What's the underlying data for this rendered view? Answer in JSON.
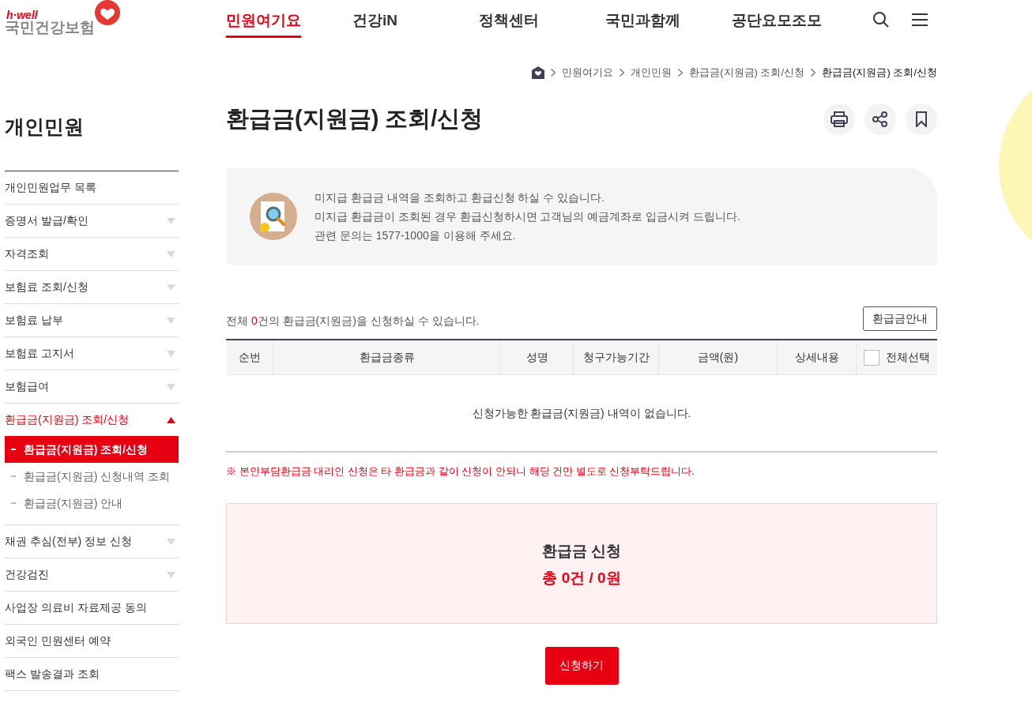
{
  "logo": {
    "tagline": "h·well",
    "name": "국민건강보험"
  },
  "nav": [
    {
      "label": "민원여기요",
      "selected": true
    },
    {
      "label": "건강iN",
      "selected": false
    },
    {
      "label": "정책센터",
      "selected": false
    },
    {
      "label": "국민과함께",
      "selected": false
    },
    {
      "label": "공단요모조모",
      "selected": false
    }
  ],
  "breadcrumb": [
    "민원여기요",
    "개인민원",
    "환급금(지원금) 조회/신청",
    "환급금(지원금) 조회/신청"
  ],
  "sidebar": {
    "title": "개인민원",
    "items": [
      {
        "label": "개인민원업무 목록",
        "kind": "link",
        "selected": false
      },
      {
        "label": "증명서 발급/확인",
        "kind": "toggle",
        "expanded": false,
        "selected": false
      },
      {
        "label": "자격조회",
        "kind": "toggle",
        "expanded": false,
        "selected": false
      },
      {
        "label": "보험료 조회/신청",
        "kind": "toggle",
        "expanded": false,
        "selected": false
      },
      {
        "label": "보험료 납부",
        "kind": "toggle",
        "expanded": false,
        "selected": false
      },
      {
        "label": "보험료 고지서",
        "kind": "toggle",
        "expanded": false,
        "selected": false
      },
      {
        "label": "보험급여",
        "kind": "toggle",
        "expanded": false,
        "selected": false
      },
      {
        "label": "환급금(지원금) 조회/신청",
        "kind": "toggle",
        "expanded": true,
        "selected": true,
        "children": [
          {
            "label": "환급금(지원금) 조회/신청",
            "selected": true
          },
          {
            "label": "환급금(지원금) 신청내역 조회",
            "selected": false
          },
          {
            "label": "환급금(지원금) 안내",
            "selected": false
          }
        ]
      },
      {
        "label": "채권 추심(전부) 정보 신청",
        "kind": "toggle",
        "expanded": false,
        "selected": false
      },
      {
        "label": "건강검진",
        "kind": "toggle",
        "expanded": false,
        "selected": false
      },
      {
        "label": "사업장 의료비 자료제공 동의",
        "kind": "link",
        "selected": false
      },
      {
        "label": "외국인 민원센터 예약",
        "kind": "link",
        "selected": false
      },
      {
        "label": "팩스 발송결과 조회",
        "kind": "link",
        "selected": false
      }
    ]
  },
  "page_title": "환급금(지원금) 조회/신청",
  "info_lines": [
    "미지급 환급금 내역을 조회하고 환급신청 하실 수 있습니다.",
    "미지급 환급금이 조회된 경우 환급신청하시면 고객님의 예금계좌로 입금시켜 드립니다.",
    "관련 문의는 1577-1000을 이용해 주세요."
  ],
  "summary": {
    "prefix": "전체 ",
    "count": "0",
    "suffix": "건의 환급금(지원금)을 신청하실 수 있습니다."
  },
  "guide_button": "환급금안내",
  "table": {
    "columns": [
      "순번",
      "환급금종류",
      "성명",
      "청구가능기간",
      "금액(원)",
      "상세내용",
      "전체선택"
    ],
    "select_all_checked": false,
    "empty_message": "신청가능한 환급금(지원금) 내역이 없습니다."
  },
  "notice": "※ 본인부담환급금 대리인 신청은 타 환급금과 같이 신청이 안되니 해당 건만 별도로 신청부탁드립니다.",
  "request_box": {
    "title": "환급금 신청",
    "total": "총 0건 / 0원"
  },
  "submit_button": "신청하기"
}
